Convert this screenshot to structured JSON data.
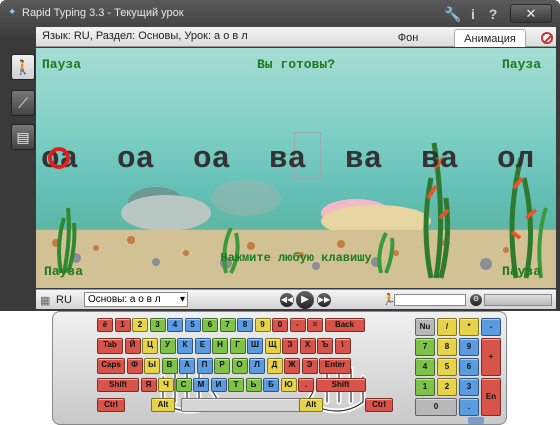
{
  "window": {
    "title": "Rapid Typing 3.3 - Текущий урок",
    "close_label": "✕"
  },
  "infobar": {
    "text": "Язык: RU,    Раздел: Основы,    Урок: а о в л",
    "tabs": [
      {
        "label": "Фон",
        "active": false
      },
      {
        "label": "Анимация",
        "active": true
      }
    ]
  },
  "scene": {
    "pause_label": "Пауза",
    "ready_text": "Вы готовы?",
    "press_text": "Нажмите любую клавишу",
    "words": [
      "оа",
      "оа",
      "оа",
      "ва",
      "ва",
      "ва",
      "ол"
    ],
    "current_char": "о"
  },
  "statusbar": {
    "lang": "RU",
    "lesson": "Основы: а о в л",
    "progress": 0.0
  },
  "keyboard": {
    "colors": {
      "red": "#d8544a",
      "orange": "#e89a2e",
      "yellow": "#e6d34a",
      "green": "#7fc24a",
      "blue": "#5b9be0",
      "gray": "#b8b8b8",
      "lightgray": "#d6d6d6"
    },
    "rows": [
      [
        {
          "l": "ё",
          "c": "red"
        },
        {
          "l": "1",
          "c": "red"
        },
        {
          "l": "2",
          "c": "yellow"
        },
        {
          "l": "3",
          "c": "green"
        },
        {
          "l": "4",
          "c": "blue"
        },
        {
          "l": "5",
          "c": "blue"
        },
        {
          "l": "6",
          "c": "green"
        },
        {
          "l": "7",
          "c": "green"
        },
        {
          "l": "8",
          "c": "blue"
        },
        {
          "l": "9",
          "c": "yellow"
        },
        {
          "l": "0",
          "c": "red"
        },
        {
          "l": "-",
          "c": "red"
        },
        {
          "l": "=",
          "c": "red"
        },
        {
          "l": "Back",
          "c": "red"
        }
      ],
      [
        {
          "l": "Tab",
          "c": "red"
        },
        {
          "l": "Й",
          "c": "red"
        },
        {
          "l": "Ц",
          "c": "yellow"
        },
        {
          "l": "У",
          "c": "green"
        },
        {
          "l": "К",
          "c": "blue"
        },
        {
          "l": "Е",
          "c": "blue"
        },
        {
          "l": "Н",
          "c": "green"
        },
        {
          "l": "Г",
          "c": "green"
        },
        {
          "l": "Ш",
          "c": "blue"
        },
        {
          "l": "Щ",
          "c": "yellow"
        },
        {
          "l": "З",
          "c": "red"
        },
        {
          "l": "Х",
          "c": "red"
        },
        {
          "l": "Ъ",
          "c": "red"
        },
        {
          "l": "\\",
          "c": "red"
        }
      ],
      [
        {
          "l": "Caps",
          "c": "red"
        },
        {
          "l": "Ф",
          "c": "red"
        },
        {
          "l": "Ы",
          "c": "yellow"
        },
        {
          "l": "В",
          "c": "green"
        },
        {
          "l": "А",
          "c": "blue"
        },
        {
          "l": "П",
          "c": "blue"
        },
        {
          "l": "Р",
          "c": "green"
        },
        {
          "l": "О",
          "c": "green"
        },
        {
          "l": "Л",
          "c": "blue"
        },
        {
          "l": "Д",
          "c": "yellow"
        },
        {
          "l": "Ж",
          "c": "red"
        },
        {
          "l": "Э",
          "c": "red"
        },
        {
          "l": "Enter",
          "c": "red"
        }
      ],
      [
        {
          "l": "Shift",
          "c": "red"
        },
        {
          "l": "Я",
          "c": "red"
        },
        {
          "l": "Ч",
          "c": "yellow"
        },
        {
          "l": "С",
          "c": "green"
        },
        {
          "l": "М",
          "c": "blue"
        },
        {
          "l": "И",
          "c": "blue"
        },
        {
          "l": "Т",
          "c": "green"
        },
        {
          "l": "Ь",
          "c": "green"
        },
        {
          "l": "Б",
          "c": "blue"
        },
        {
          "l": "Ю",
          "c": "yellow"
        },
        {
          "l": ".",
          "c": "red"
        },
        {
          "l": "Shift",
          "c": "red"
        }
      ],
      [
        {
          "l": "Ctrl",
          "c": "red"
        },
        {
          "l": "Alt",
          "c": "yellow"
        },
        {
          "l": "",
          "c": "lightgray"
        },
        {
          "l": "Alt",
          "c": "yellow"
        },
        {
          "l": "Ctrl",
          "c": "red"
        }
      ]
    ],
    "numpad": [
      "Nu",
      "/",
      "*",
      "-",
      "7",
      "8",
      "9",
      "+",
      "4",
      "5",
      "6",
      "1",
      "2",
      "3",
      "En",
      "0",
      "."
    ]
  }
}
